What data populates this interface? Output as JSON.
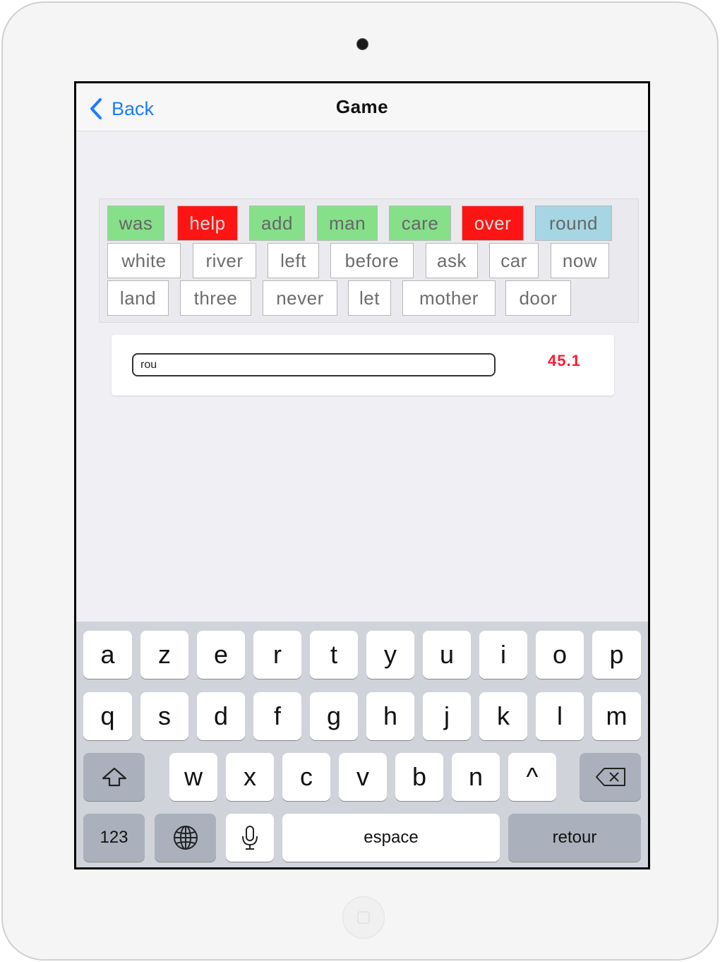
{
  "navbar": {
    "back_label": "Back",
    "title": "Game"
  },
  "words": [
    {
      "text": "was",
      "status": "correct"
    },
    {
      "text": "help",
      "status": "wrong"
    },
    {
      "text": "add",
      "status": "correct"
    },
    {
      "text": "man",
      "status": "correct"
    },
    {
      "text": "care",
      "status": "correct"
    },
    {
      "text": "over",
      "status": "wrong"
    },
    {
      "text": "round",
      "status": "current"
    },
    {
      "text": "white",
      "status": "pending"
    },
    {
      "text": "river",
      "status": "pending"
    },
    {
      "text": "left",
      "status": "pending"
    },
    {
      "text": "before",
      "status": "pending"
    },
    {
      "text": "ask",
      "status": "pending"
    },
    {
      "text": "car",
      "status": "pending"
    },
    {
      "text": "now",
      "status": "pending"
    },
    {
      "text": "land",
      "status": "pending"
    },
    {
      "text": "three",
      "status": "pending"
    },
    {
      "text": "never",
      "status": "pending"
    },
    {
      "text": "let",
      "status": "pending"
    },
    {
      "text": "mother",
      "status": "pending"
    },
    {
      "text": "door",
      "status": "pending"
    }
  ],
  "input": {
    "value": "rou"
  },
  "timer": {
    "value": "45.1"
  },
  "keyboard": {
    "row1": [
      "a",
      "z",
      "e",
      "r",
      "t",
      "y",
      "u",
      "i",
      "o",
      "p"
    ],
    "row2": [
      "q",
      "s",
      "d",
      "f",
      "g",
      "h",
      "j",
      "k",
      "l",
      "m"
    ],
    "row3": [
      "w",
      "x",
      "c",
      "v",
      "b",
      "n",
      "^"
    ],
    "numbers_label": "123",
    "space_label": "espace",
    "return_label": "retour"
  },
  "colors": {
    "correct": "#86e08a",
    "wrong": "#ff1414",
    "current": "#a6d6e4",
    "accent": "#1a7cff",
    "timer": "#ff1a2e"
  },
  "icons": {
    "back": "chevron-left-icon",
    "shift": "shift-arrow-icon",
    "delete": "backspace-icon",
    "globe": "globe-icon",
    "mic": "microphone-icon"
  }
}
